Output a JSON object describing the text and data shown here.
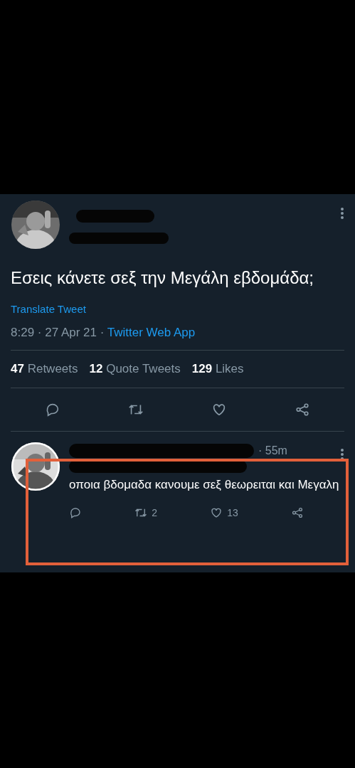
{
  "tweet": {
    "text": "Εσεις κάνετε σεξ την Μεγάλη εβδομάδα;",
    "translate": "Translate Tweet",
    "time": "8:29 · 27 Apr 21 · ",
    "source": "Twitter Web App",
    "stats": [
      {
        "count": "47",
        "label": "Retweets"
      },
      {
        "count": "12",
        "label": "Quote Tweets"
      },
      {
        "count": "129",
        "label": "Likes"
      }
    ],
    "actions": [
      {
        "kind": "reply"
      },
      {
        "kind": "retweet"
      },
      {
        "kind": "like"
      },
      {
        "kind": "share"
      }
    ]
  },
  "reply": {
    "time": "· 55m",
    "text": "οποια βδομαδα κανουμε σεξ θεωρειται και Μεγαλη",
    "actions": [
      {
        "kind": "reply"
      },
      {
        "kind": "retweet",
        "count": "2"
      },
      {
        "kind": "like",
        "count": "13"
      },
      {
        "kind": "share"
      }
    ]
  }
}
